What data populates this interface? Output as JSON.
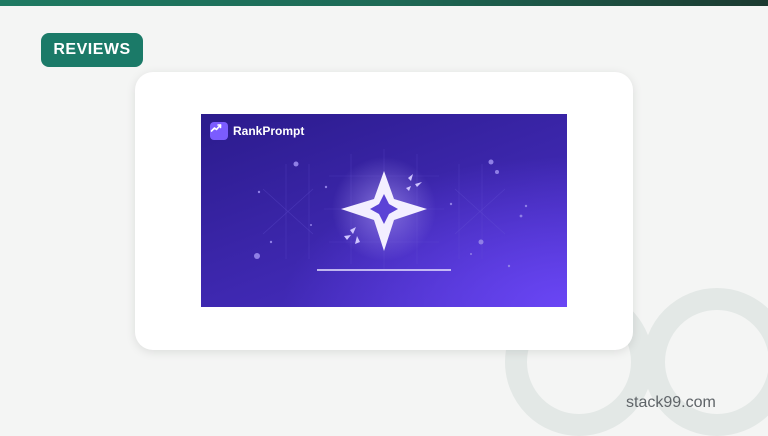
{
  "header": {
    "badge_label": "REVIEWS"
  },
  "banner": {
    "brand_name": "RankPrompt"
  },
  "footer": {
    "site": "stack99.com"
  },
  "colors": {
    "accent": "#1b7a68",
    "banner_start": "#2b1b8c",
    "banner_end": "#6a46f5"
  },
  "icons": [
    "trend-chart-icon",
    "star-logo-icon"
  ]
}
